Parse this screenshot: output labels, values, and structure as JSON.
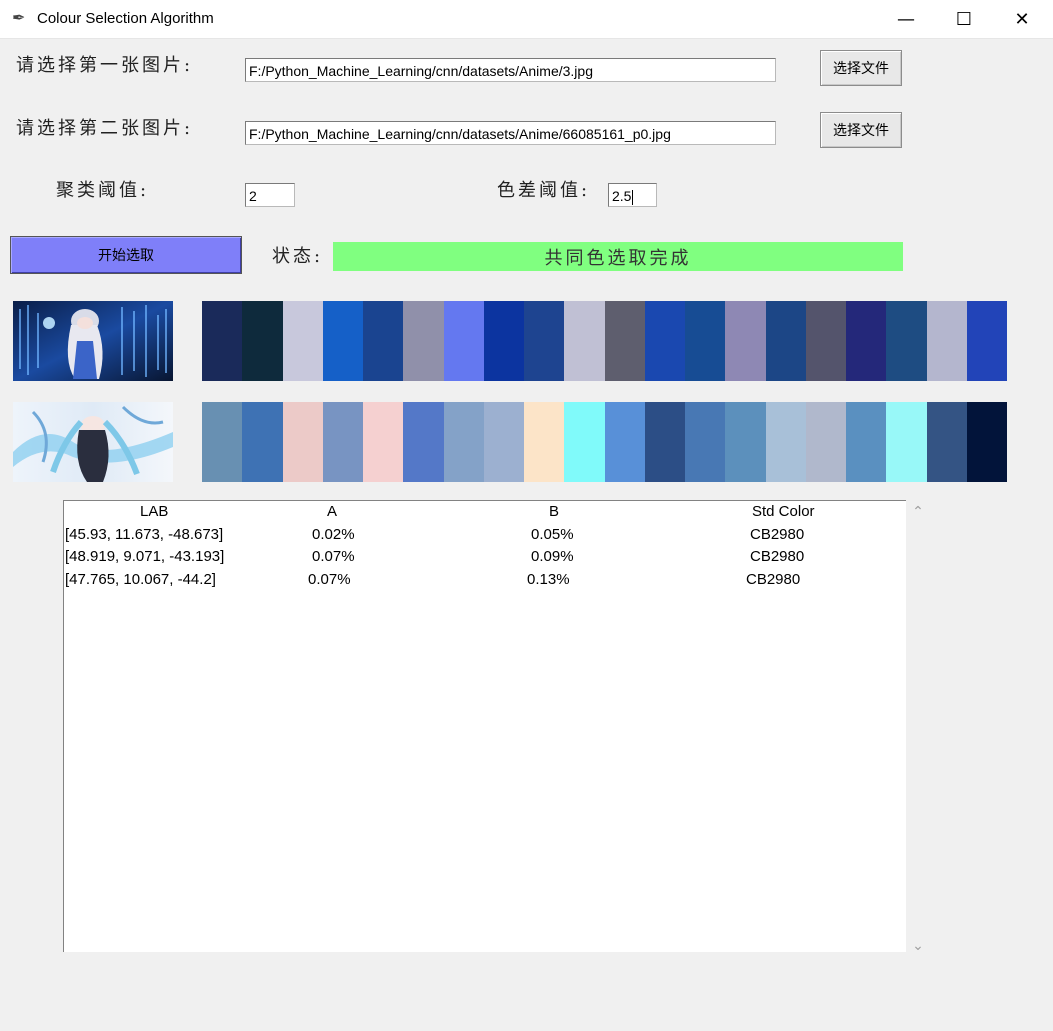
{
  "window": {
    "title": "Colour Selection Algorithm",
    "controls": {
      "minimize": "—",
      "maximize": "☐",
      "close": "✕"
    }
  },
  "form": {
    "image1_label": "请选择第一张图片:",
    "image1_path": "F:/Python_Machine_Learning/cnn/datasets/Anime/3.jpg",
    "image2_label": "请选择第二张图片:",
    "image2_path": "F:/Python_Machine_Learning/cnn/datasets/Anime/66085161_p0.jpg",
    "choose_file_label": "选择文件",
    "cluster_threshold_label": "聚类阈值:",
    "cluster_threshold_value": "2",
    "color_diff_label": "色差阈值:",
    "color_diff_value": "2.5"
  },
  "actions": {
    "start_label": "开始选取",
    "status_label": "状态:",
    "status_text": "共同色选取完成",
    "start_color": "#7f7ff9",
    "status_color": "#80ff80"
  },
  "palettes": {
    "image1": [
      "#1a2a5a",
      "#0e2a3c",
      "#c8c8dc",
      "#1560c8",
      "#1a4490",
      "#9090aa",
      "#6478f0",
      "#0c34a0",
      "#1e4490",
      "#c0c0d4",
      "#5e5e6e",
      "#1a48b0",
      "#174c94",
      "#8e88b4",
      "#1c4686",
      "#54546c",
      "#24287a",
      "#1e4c82",
      "#b4b6ce",
      "#2244b8"
    ],
    "image2": [
      "#6890b2",
      "#3e72b4",
      "#eccac8",
      "#7894c2",
      "#f5d0d0",
      "#5478c8",
      "#84a2c8",
      "#9cb0d0",
      "#fce4c8",
      "#80fafa",
      "#5890d8",
      "#2c4e86",
      "#4878b4",
      "#5c90bc",
      "#a8c0d8",
      "#b0b8cc",
      "#5a90c0",
      "#98f8f8",
      "#345484",
      "#02143a"
    ]
  },
  "results": {
    "headers": [
      "LAB",
      "A",
      "B",
      "Std Color"
    ],
    "rows": [
      [
        "[45.93, 11.673, -48.673]",
        "0.02%",
        "0.05%",
        "CB2980"
      ],
      [
        "[48.919, 9.071, -43.193]",
        "0.07%",
        "0.09%",
        "CB2980"
      ],
      [
        "[47.765, 10.067, -44.2]",
        "0.07%",
        "0.13%",
        "CB2980"
      ]
    ]
  },
  "scroll": {
    "up": "⌃",
    "down": "⌄"
  }
}
